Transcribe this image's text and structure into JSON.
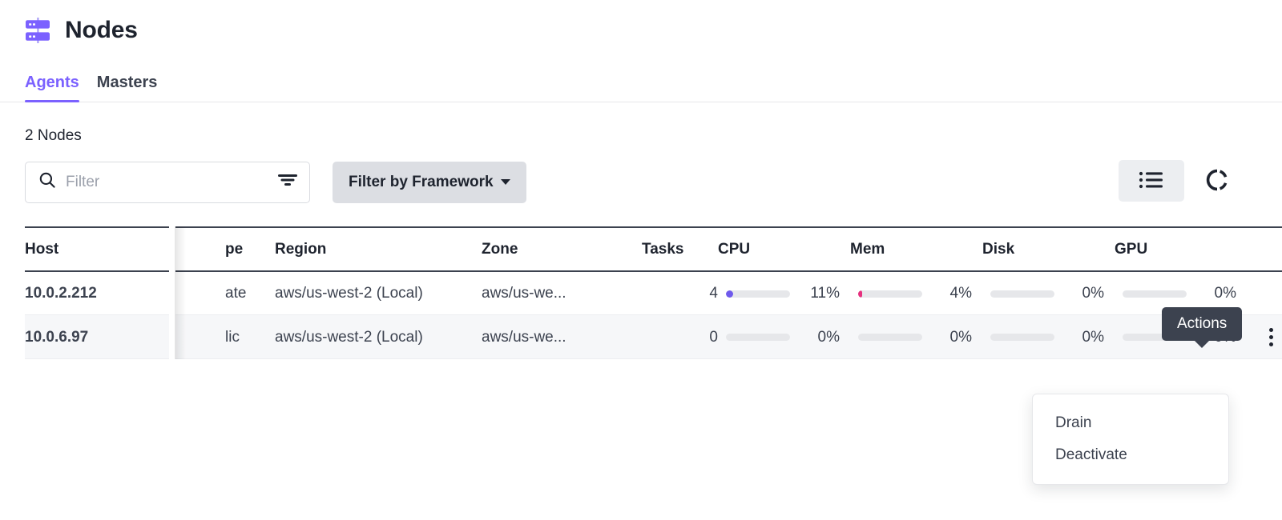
{
  "header": {
    "title": "Nodes",
    "icon": "nodes-icon"
  },
  "tabs": [
    {
      "label": "Agents",
      "active": true
    },
    {
      "label": "Masters",
      "active": false
    }
  ],
  "summary": {
    "count_label": "2 Nodes"
  },
  "toolbar": {
    "search": {
      "placeholder": "Filter",
      "value": "",
      "icon": "search-icon",
      "trailing_icon": "funnel-icon"
    },
    "framework_filter": {
      "label": "Filter by Framework",
      "icon": "chevron-down-icon"
    },
    "view_toggle": {
      "icon": "list-view-icon",
      "active": true
    },
    "refresh": {
      "icon": "refresh-icon"
    }
  },
  "table": {
    "columns": [
      "Host",
      "Type",
      "Region",
      "Zone",
      "Tasks",
      "CPU",
      "Mem",
      "Disk",
      "GPU"
    ],
    "column_truncated": {
      "Type": "pe"
    },
    "rows": [
      {
        "host": "10.0.2.212",
        "type": "ate",
        "region": "aws/us-west-2 (Local)",
        "zone": "aws/us-we...",
        "tasks": "4",
        "cpu": {
          "pct_label": "11%",
          "value": 11,
          "color": "#6f5aec"
        },
        "mem": {
          "pct_label": "4%",
          "value": 4,
          "color": "#e6307e"
        },
        "disk": {
          "pct_label": "0%",
          "value": 0,
          "color": "#e6e7ea"
        },
        "gpu": {
          "pct_label": "0%",
          "value": 0,
          "color": "#e6e7ea"
        },
        "highlighted": false
      },
      {
        "host": "10.0.6.97",
        "type": "lic",
        "region": "aws/us-west-2 (Local)",
        "zone": "aws/us-we...",
        "tasks": "0",
        "cpu": {
          "pct_label": "0%",
          "value": 0,
          "color": "#e6e7ea"
        },
        "mem": {
          "pct_label": "0%",
          "value": 0,
          "color": "#e6e7ea"
        },
        "disk": {
          "pct_label": "0%",
          "value": 0,
          "color": "#e6e7ea"
        },
        "gpu": {
          "pct_label": "0%",
          "value": 0,
          "color": "#e6e7ea"
        },
        "highlighted": true
      }
    ]
  },
  "tooltip": {
    "text": "Actions"
  },
  "dropdown": {
    "items": [
      {
        "label": "Drain"
      },
      {
        "label": "Deactivate"
      }
    ]
  },
  "colors": {
    "accent": "#7b61ff",
    "cpu_bar": "#6f5aec",
    "mem_bar": "#e6307e",
    "track": "#e6e7ea",
    "tooltip_bg": "#3c424f",
    "row_hover": "#f6f7f9"
  }
}
